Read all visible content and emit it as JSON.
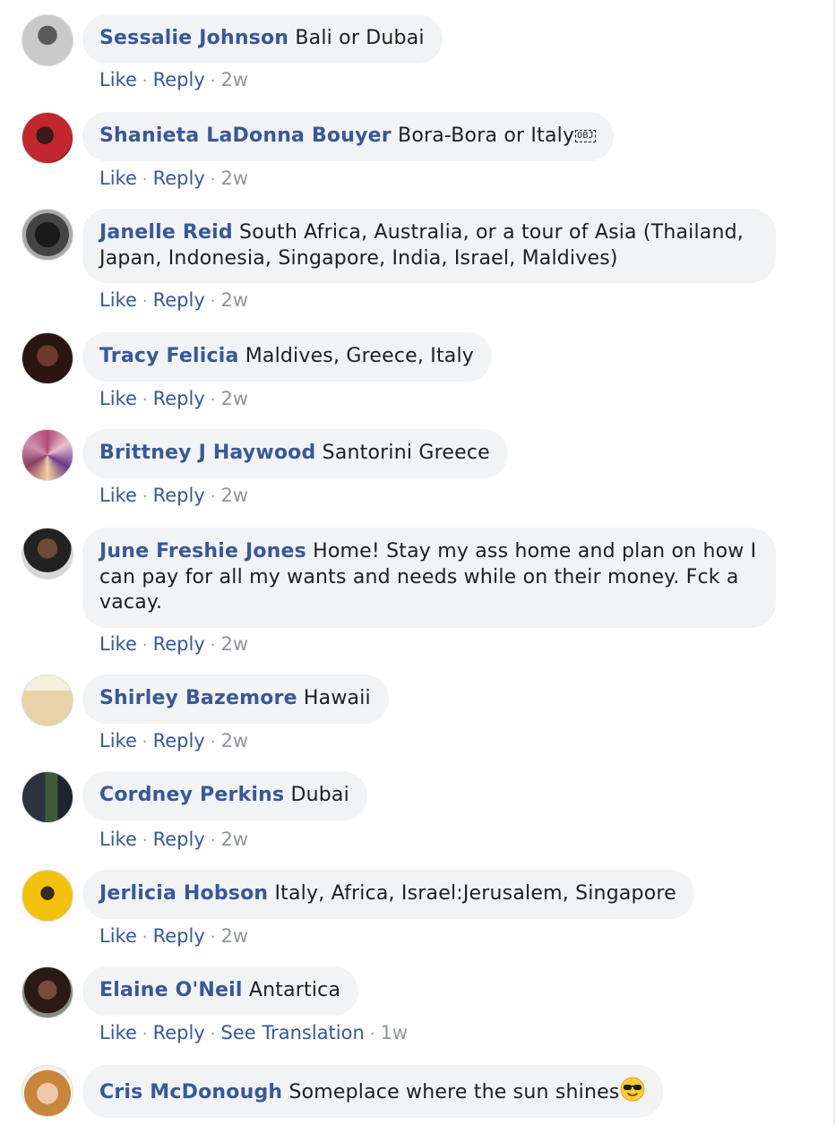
{
  "comments": [
    {
      "name": "Sessalie Johnson",
      "text": "Bali or Dubai",
      "like": "Like",
      "reply": "Reply",
      "time": "2w"
    },
    {
      "name": "Shanieta LaDonna Bouyer",
      "text": "Bora-Bora or Italy",
      "obj": "OBJ",
      "like": "Like",
      "reply": "Reply",
      "time": "2w"
    },
    {
      "name": "Janelle Reid",
      "text": "South Africa, Australia, or a tour of Asia (Thailand, Japan, Indonesia, Singapore, India, Israel, Maldives)",
      "like": "Like",
      "reply": "Reply",
      "time": "2w"
    },
    {
      "name": "Tracy Felicia",
      "text": "Maldives, Greece, Italy",
      "like": "Like",
      "reply": "Reply",
      "time": "2w"
    },
    {
      "name": "Brittney J Haywood",
      "text": "Santorini Greece",
      "like": "Like",
      "reply": "Reply",
      "time": "2w"
    },
    {
      "name": "June Freshie Jones",
      "text": "Home! Stay my ass home and plan on how I can pay for all my wants and needs while on their money. Fck a vacay.",
      "like": "Like",
      "reply": "Reply",
      "time": "2w"
    },
    {
      "name": "Shirley Bazemore",
      "text": "Hawaii",
      "like": "Like",
      "reply": "Reply",
      "time": "2w"
    },
    {
      "name": "Cordney Perkins",
      "text": "Dubai",
      "like": "Like",
      "reply": "Reply",
      "time": "2w"
    },
    {
      "name": "Jerlicia Hobson",
      "text": "Italy, Africa, Israel:Jerusalem, Singapore",
      "like": "Like",
      "reply": "Reply",
      "time": "2w"
    },
    {
      "name": "Elaine O'Neil",
      "text": "Antartica",
      "like": "Like",
      "reply": "Reply",
      "translate": "See Translation",
      "time": "1w"
    },
    {
      "name": "Cris McDonough",
      "text": "Someplace where the sun shines",
      "emoji": "sunglasses-emoji"
    }
  ],
  "colors": {
    "name": "#385898",
    "bubble": "#f2f3f5",
    "meta": "#90949c"
  }
}
